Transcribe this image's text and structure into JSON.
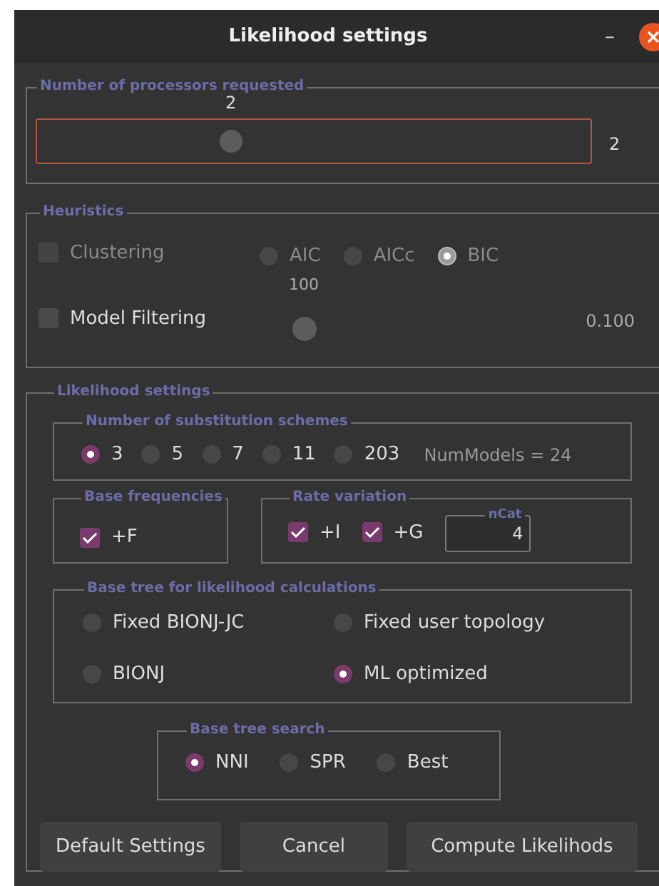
{
  "window": {
    "title": "Likelihood settings",
    "minimize": "–"
  },
  "processors": {
    "legend": "Number of processors requested",
    "thumb_label": "2",
    "level": 0.35,
    "value": "2"
  },
  "heuristics": {
    "legend": "Heuristics",
    "clustering": {
      "label": "Clustering",
      "checked": false,
      "disabled": true
    },
    "criteria_disabled": true,
    "criteria": [
      {
        "label": "AIC",
        "selected": false
      },
      {
        "label": "AICc",
        "selected": false
      },
      {
        "label": "BIC",
        "selected": true
      }
    ],
    "model_filtering": {
      "label": "Model Filtering",
      "checked": false,
      "disabled": false,
      "thumb_label": "100",
      "value": "0.100"
    }
  },
  "likelihood": {
    "legend": "Likelihood settings",
    "schemes": {
      "legend": "Number of substitution schemes",
      "options": [
        {
          "label": "3",
          "selected": true
        },
        {
          "label": "5",
          "selected": false
        },
        {
          "label": "7",
          "selected": false
        },
        {
          "label": "11",
          "selected": false
        },
        {
          "label": "203",
          "selected": false
        }
      ],
      "num_models": "NumModels = 24"
    },
    "base_frequencies": {
      "legend": "Base frequencies",
      "options": [
        {
          "label": "+F",
          "checked": true
        }
      ]
    },
    "rate_variation": {
      "legend": "Rate variation",
      "options": [
        {
          "label": "+I",
          "checked": true
        },
        {
          "label": "+G",
          "checked": true
        }
      ],
      "ncat": {
        "label": "nCat",
        "value": "4"
      }
    },
    "base_tree": {
      "legend": "Base tree for likelihood calculations",
      "options": [
        {
          "label": "Fixed BIONJ-JC",
          "selected": false
        },
        {
          "label": "Fixed user topology",
          "selected": false
        },
        {
          "label": "BIONJ",
          "selected": false
        },
        {
          "label": "ML optimized",
          "selected": true
        }
      ]
    },
    "tree_search": {
      "legend": "Base tree search",
      "options": [
        {
          "label": "NNI",
          "selected": true
        },
        {
          "label": "SPR",
          "selected": false
        },
        {
          "label": "Best",
          "selected": false
        }
      ]
    }
  },
  "buttons": [
    "Default Settings",
    "Cancel",
    "Compute Likelihods"
  ]
}
